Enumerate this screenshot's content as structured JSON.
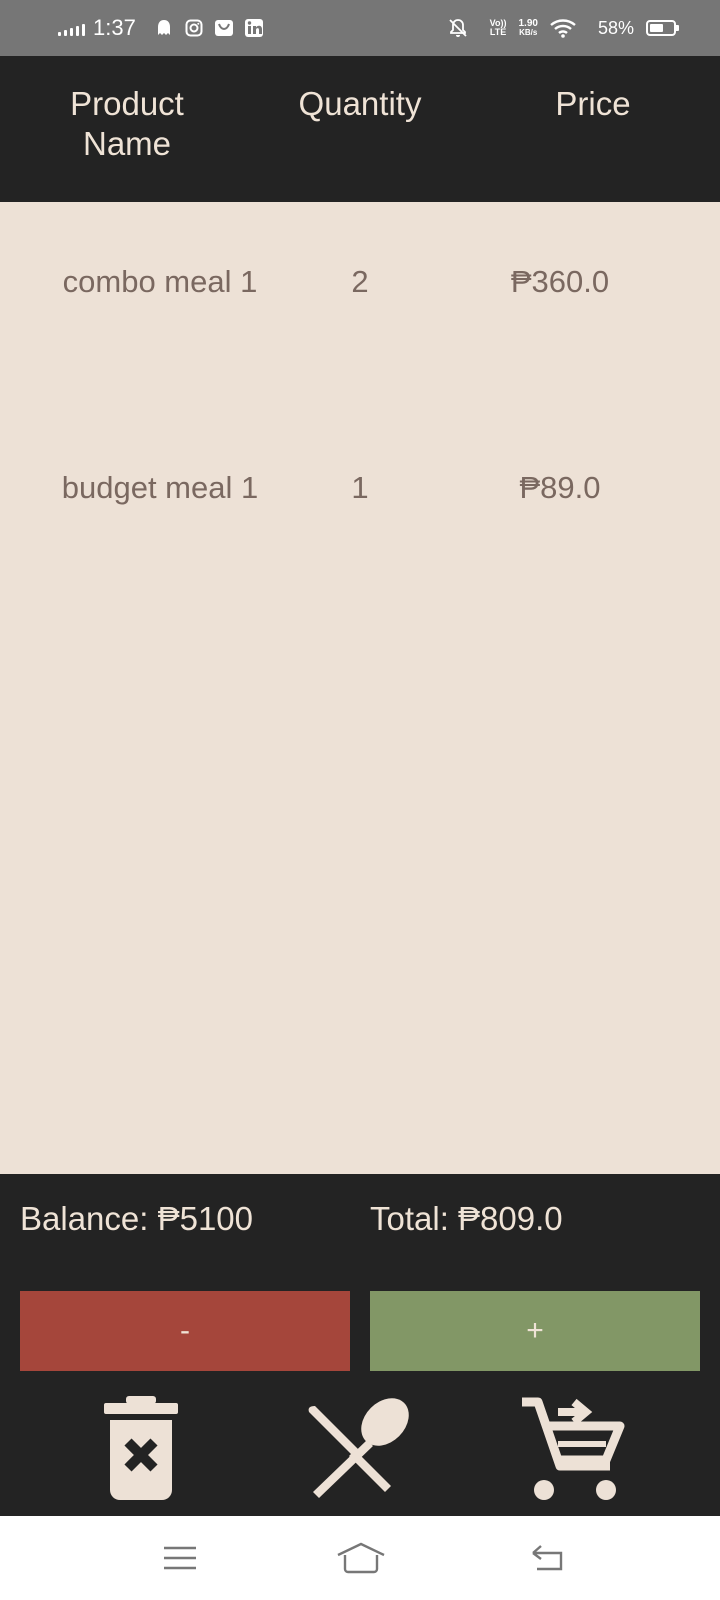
{
  "status_bar": {
    "time": "1:37",
    "volte": "Vo))",
    "lte": "LTE",
    "speed_value": "1.90",
    "speed_unit": "KB/s",
    "battery_percent": "58%",
    "battery_level": 0.58
  },
  "table": {
    "headers": {
      "product_name": "Product Name",
      "quantity": "Quantity",
      "price": "Price"
    },
    "rows": [
      {
        "name": "combo meal 1",
        "quantity": "2",
        "price": "₱360.0"
      },
      {
        "name": "budget meal 1",
        "quantity": "1",
        "price": "₱89.0"
      }
    ]
  },
  "footer": {
    "balance": "Balance: ₱5100",
    "total": "Total: ₱809.0",
    "minus_label": "-",
    "plus_label": "+",
    "icons": [
      "trash-icon",
      "utensils-icon",
      "cart-checkout-icon"
    ]
  },
  "colors": {
    "background": "#ede1d6",
    "dark": "#232323",
    "minus_button": "#a5463b",
    "plus_button": "#829766",
    "row_text": "#7a6860"
  }
}
